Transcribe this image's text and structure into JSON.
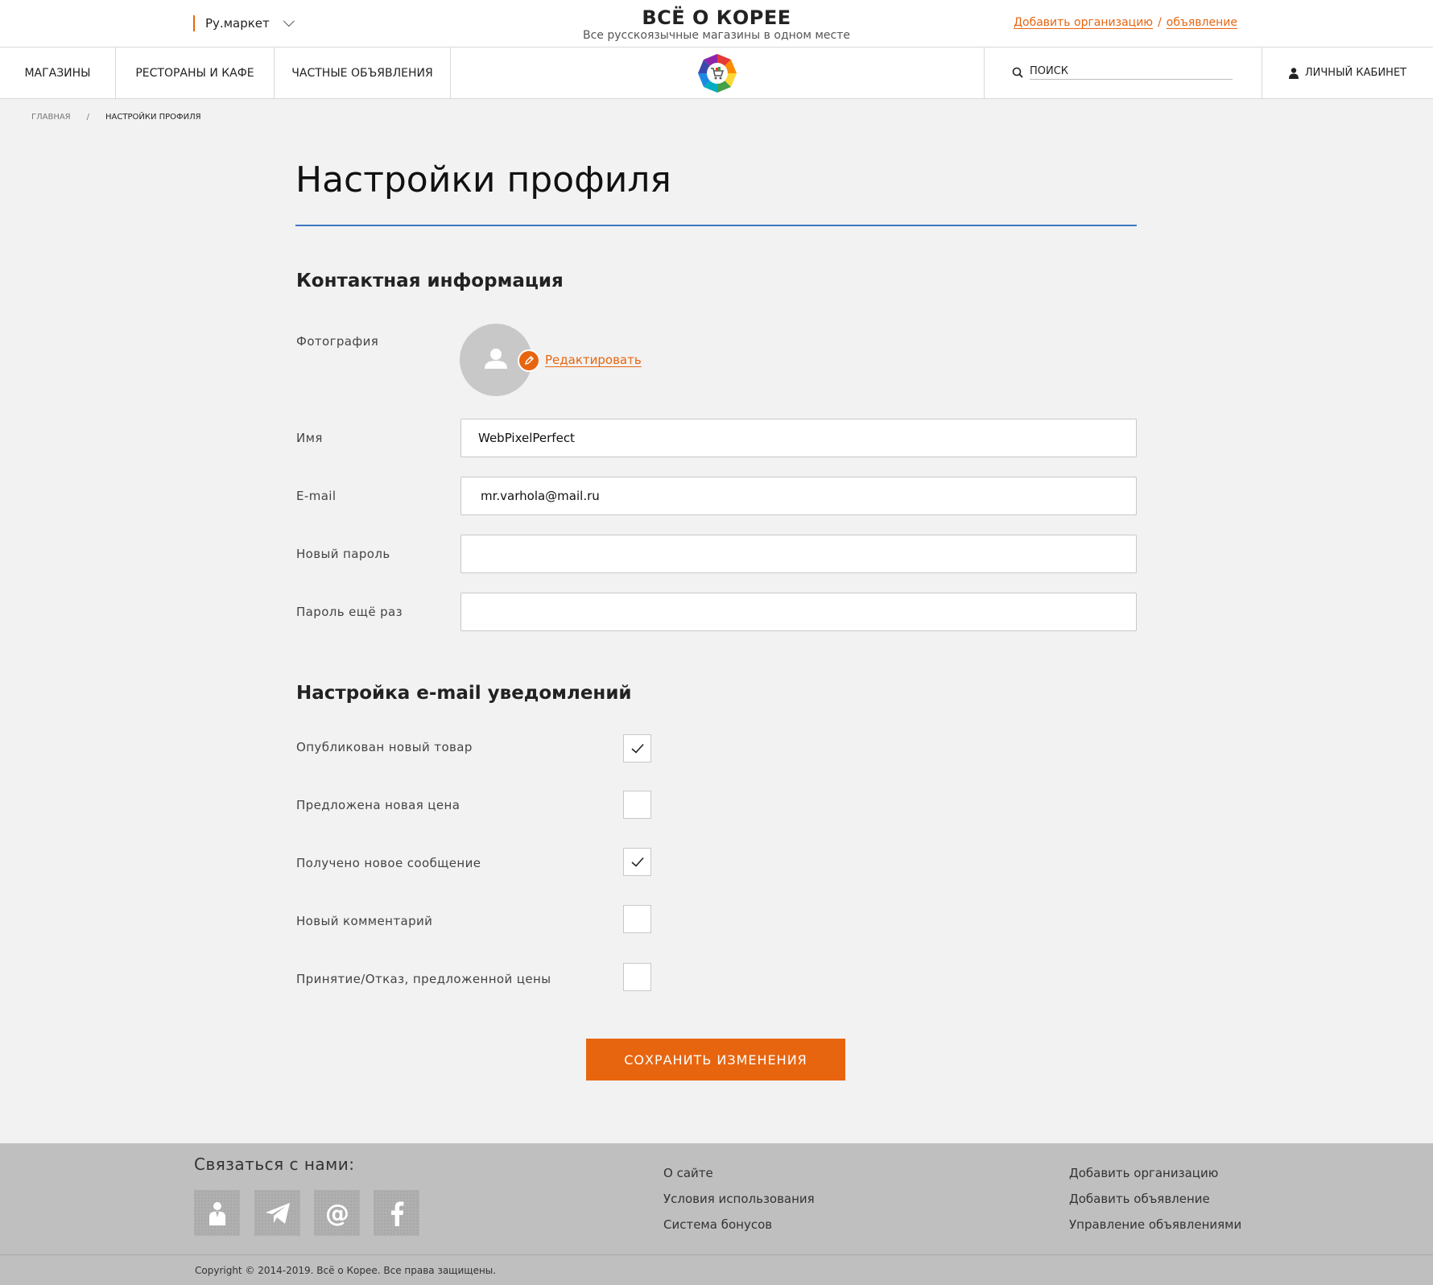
{
  "header": {
    "city": "Ру.маркет",
    "title": "ВСЁ О КОРЕЕ",
    "subtitle": "Все русскоязычные магазины в одном месте",
    "add_org": "Добавить организацию",
    "add_sep": "/",
    "add_ad": "объявление"
  },
  "nav": {
    "items": [
      "МАГАЗИНЫ",
      "РЕСТОРАНЫ И КАФЕ",
      "ЧАСТНЫЕ ОБЪЯВЛЕНИЯ"
    ],
    "search_placeholder": "ПОИСК",
    "cabinet": "ЛИЧНЫЙ КАБИНЕТ"
  },
  "breadcrumb": {
    "home": "ГЛАВНАЯ",
    "sep": "/",
    "current": "НАСТРОЙКИ ПРОФИЛЯ"
  },
  "page": {
    "title": "Настройки профиля",
    "contact_heading": "Контактная информация",
    "photo_label": "Фотография",
    "edit_link": "Редактировать",
    "name_label": "Имя",
    "name_value": "WebPixelPerfect",
    "email_label": "E-mail",
    "email_value": "mr.varhola@mail.ru",
    "password_label": "Новый пароль",
    "password_value": "",
    "password2_label": "Пароль ещё раз",
    "password2_value": "",
    "notif_heading": "Настройка e-mail уведомлений",
    "notifications": [
      {
        "label": "Опубликован новый товар",
        "checked": true
      },
      {
        "label": "Предложена новая цена",
        "checked": false
      },
      {
        "label": "Получено новое сообщение",
        "checked": true
      },
      {
        "label": "Новый комментарий",
        "checked": false
      },
      {
        "label": "Принятие/Отказ, предложенной цены",
        "checked": false
      }
    ],
    "save_button": "СОХРАНИТЬ ИЗМЕНЕНИЯ"
  },
  "footer": {
    "contact_heading": "Связаться с нами:",
    "social_icons": [
      "user-icon",
      "telegram-icon",
      "at-icon",
      "facebook-icon"
    ],
    "col1": [
      "О сайте",
      "Условия использования",
      "Система бонусов"
    ],
    "col2": [
      "Добавить организацию",
      "Добавить объявление",
      "Управление объявлениями"
    ],
    "copyright": "Copyright © 2014-2019. Всё о Корее. Все права защищены."
  },
  "colors": {
    "accent": "#e8650f",
    "title_rule": "#3b78c4",
    "background": "#f2f2f2",
    "footer": "#bfbfbf"
  }
}
